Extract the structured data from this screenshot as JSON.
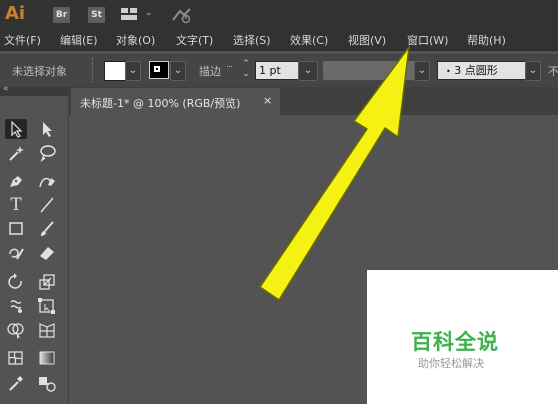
{
  "app": {
    "logo": "Ai",
    "bridge": "Br",
    "stock": "St"
  },
  "menu": [
    {
      "label": "文件(F)"
    },
    {
      "label": "编辑(E)"
    },
    {
      "label": "对象(O)"
    },
    {
      "label": "文字(T)"
    },
    {
      "label": "选择(S)"
    },
    {
      "label": "效果(C)"
    },
    {
      "label": "视图(V)"
    },
    {
      "label": "窗口(W)"
    },
    {
      "label": "帮助(H)"
    }
  ],
  "control": {
    "no_selection": "未选择对象",
    "stroke_label": "描边",
    "stroke_value": "1 pt",
    "brush_value": "3 点圆形",
    "opacity_label": "不"
  },
  "document": {
    "tab_title": "未标题-1* @ 100% (RGB/预览)",
    "tab_close": "×"
  },
  "watermark": {
    "main": "百科全说",
    "sub": "助你轻松解决"
  },
  "colors": {
    "annotation_arrow": "#f5f213",
    "watermark_green": "#3fb04a",
    "ai_orange": "#c9822f"
  },
  "icons": {
    "selection": "selection-arrow-icon",
    "direct_selection": "direct-selection-icon",
    "magic_wand": "magic-wand-icon",
    "lasso": "lasso-icon",
    "pen": "pen-icon",
    "curvature": "curvature-icon",
    "type": "type-icon",
    "line": "line-segment-icon",
    "rectangle": "rectangle-icon",
    "paintbrush": "paintbrush-icon",
    "shaper": "shaper-icon",
    "eraser": "eraser-icon",
    "rotate": "rotate-icon",
    "scale": "scale-icon",
    "warp": "warp-icon",
    "free_transform": "free-transform-icon",
    "shape_builder": "shape-builder-icon",
    "perspective": "perspective-grid-icon",
    "mesh": "mesh-icon",
    "gradient": "gradient-icon",
    "eyedropper": "eyedropper-icon",
    "blend": "blend-icon"
  }
}
